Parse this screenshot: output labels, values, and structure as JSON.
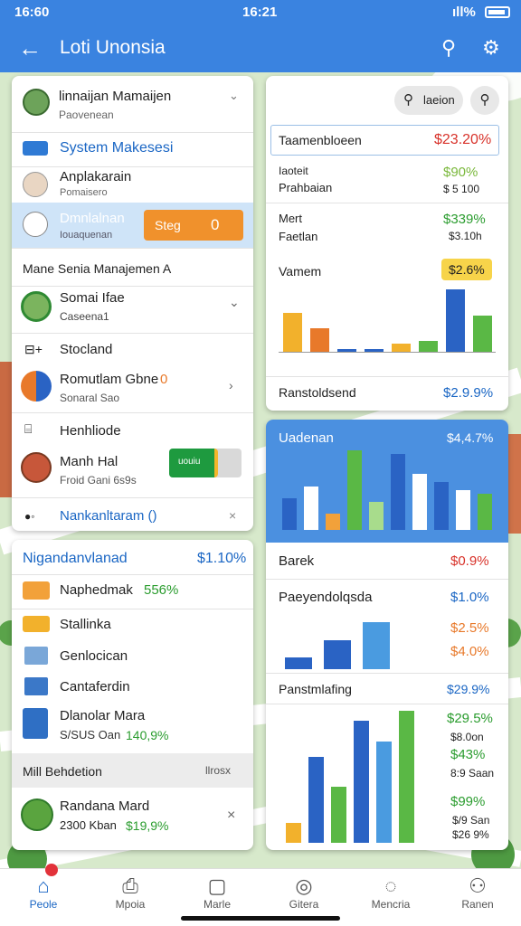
{
  "status": {
    "time": "16:60",
    "center": "16:21",
    "signal": "ıll%"
  },
  "appbar": {
    "title": "Loti Unonsia"
  },
  "left_card1": {
    "profile_name": "linnaijan Mamaijen",
    "profile_sub": "Paovenean",
    "system": "System Makesesi",
    "item1_title": "Anplakarain",
    "item1_sub": "Pomaisero",
    "item2_title": "Dmnlalnan",
    "item2_sub": "Iouaquenan",
    "item2_chip": "Steg",
    "item2_toggle": "0",
    "section": "Mane Senia Manajemen A",
    "item3_title": "Somai Ifae",
    "item3_sub": "Caseena1",
    "item4_title": "Stocland",
    "item5_title": "Romutlam Gbne",
    "item5_badge": "0",
    "item5_sub": "Sonaral Sao",
    "item6_title": "Henhliode",
    "item7_title": "Manh Hal",
    "item7_sub": "Froid Gani 6s9s",
    "item7_chip": "uouiu",
    "footer": "Nankanltaram ()"
  },
  "left_card2": {
    "header": "Nigandanvlanad",
    "header_val": "$1.10%",
    "r1": "Naphedmak",
    "r1_val": "556%",
    "r2": "Stallinka",
    "r3": "Genlocican",
    "r4": "Cantaferdin",
    "r5_title": "Dlanolar Mara",
    "r5_sub": "S/SUS Oan",
    "r5_val": "140,9%",
    "section": "Mill Behdetion",
    "section_right": "llrosx",
    "r6_title": "Randana Mard",
    "r6_sub": "2300 Kban",
    "r6_val": "$19,9%"
  },
  "right_card1": {
    "search": "laeion",
    "h1": "Taamenbloeen",
    "h1_val": "$23.20%",
    "r1a": "Iaoteit",
    "r1a_val": "$90%",
    "r1b": "Prahbaian",
    "r1b_val": "$ 5 100",
    "r2a": "Mert",
    "r2a_val": "$339%",
    "r2b": "Faetlan",
    "r2b_val": "$3.10h",
    "chart_title": "Vamem",
    "chart_badge": "$2.6%",
    "footer": "Ranstoldsend",
    "footer_val": "$2.9.9%"
  },
  "right_card2": {
    "title": "Uadenan",
    "title_val": "$4,4.7%",
    "r1": "Barek",
    "r1_val": "$0.9%",
    "r2": "Paeyendolqsda",
    "r2_val": "$1.0%",
    "r2b_val": "$2.5%",
    "r2c_val": "$4.0%",
    "r3": "Panstmlafing",
    "r3_val": "$29.9%",
    "v1": "$29.5%",
    "v1s": "$8.0on",
    "v2": "$43%",
    "v2s": "8:9 Saan",
    "v3": "$99%",
    "v3s": "$/9 San",
    "v4": "$26 9%"
  },
  "chart_data": [
    {
      "type": "bar",
      "values": [
        50,
        30,
        4,
        3,
        10,
        14,
        80,
        46
      ]
    },
    {
      "type": "bar",
      "values": [
        40,
        55,
        20,
        100,
        35,
        95,
        70,
        60,
        50,
        45
      ]
    },
    {
      "type": "bar",
      "values": [
        10,
        25,
        40
      ]
    },
    {
      "type": "bar",
      "values": [
        20,
        85,
        55,
        120,
        100,
        130
      ]
    }
  ],
  "nav": [
    {
      "label": "Peole"
    },
    {
      "label": "Mpoia"
    },
    {
      "label": "Marle"
    },
    {
      "label": "Gitera"
    },
    {
      "label": "Mencria"
    },
    {
      "label": "Ranen"
    }
  ]
}
